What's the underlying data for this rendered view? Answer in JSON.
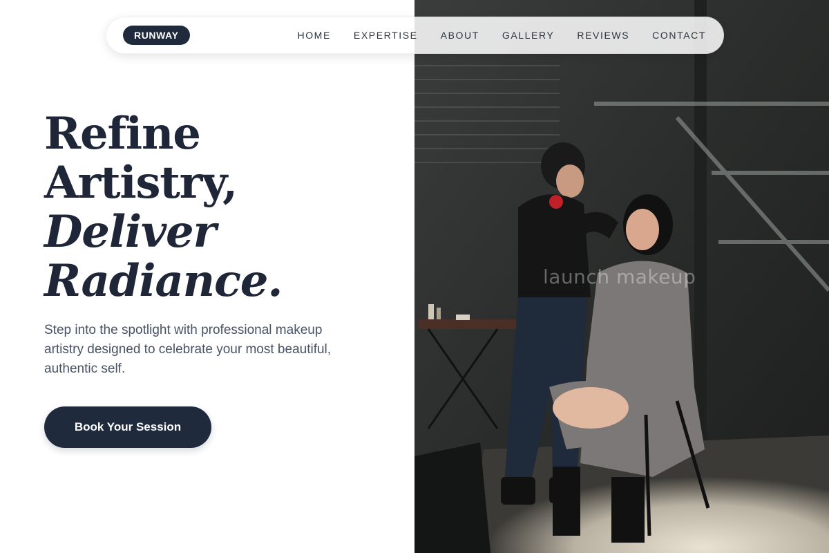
{
  "nav": {
    "brand": "RUNWAY",
    "links": [
      {
        "label": "HOME"
      },
      {
        "label": "EXPERTISE"
      },
      {
        "label": "ABOUT"
      },
      {
        "label": "GALLERY"
      },
      {
        "label": "REVIEWS"
      },
      {
        "label": "CONTACT"
      }
    ]
  },
  "hero": {
    "title_lines": [
      "Refine",
      "Artistry,",
      "Deliver",
      "Radiance."
    ],
    "subtitle": "Step into the spotlight with professional makeup artistry designed to celebrate your most beautiful, authentic self.",
    "cta_label": "Book Your Session"
  },
  "photo": {
    "caption": "launch makeup"
  },
  "colors": {
    "accent": "#1f2a3d",
    "heading": "#1e2638",
    "body_text": "#475265",
    "background": "#ffffff"
  }
}
